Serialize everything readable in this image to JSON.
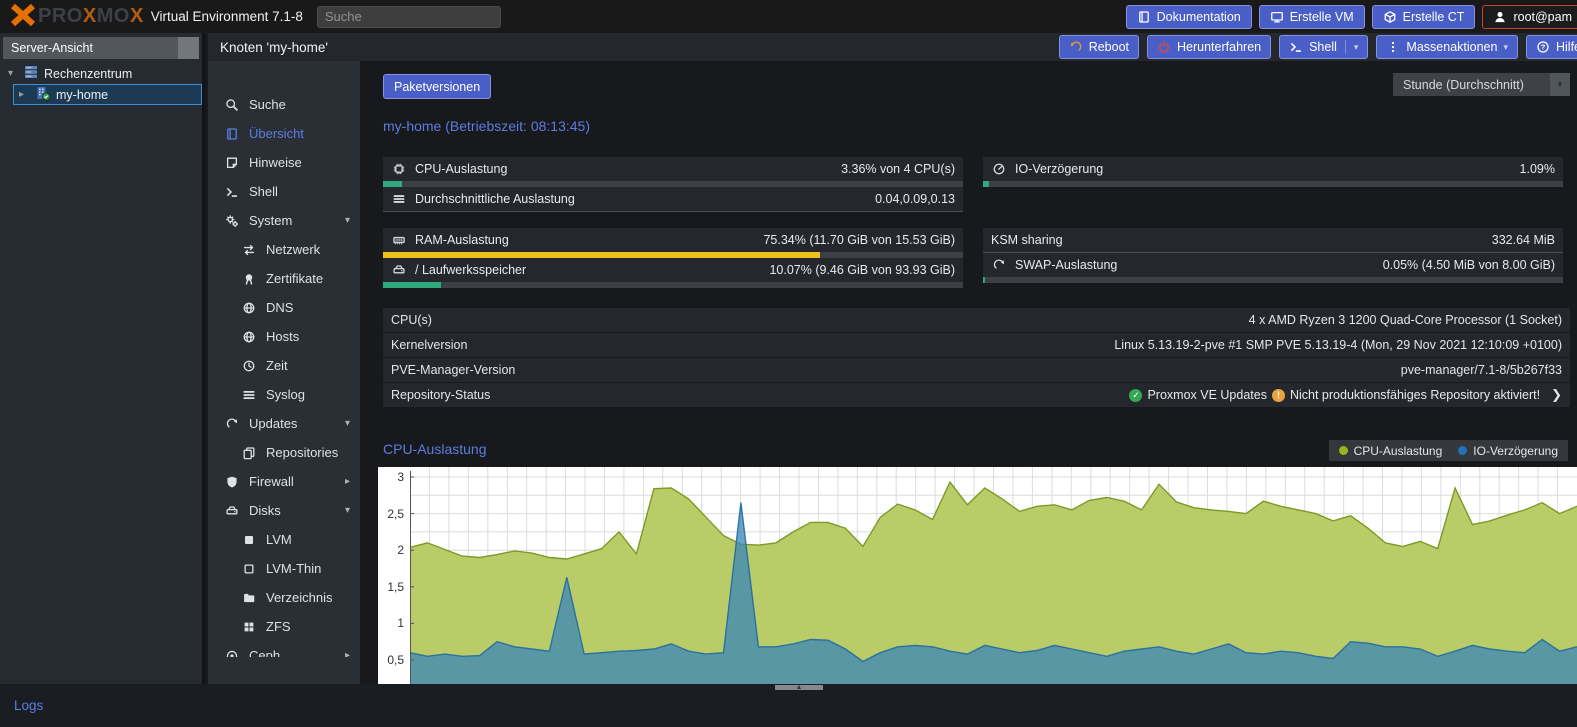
{
  "topbar": {
    "logo_text": "PROXMOX",
    "env_text": "Virtual Environment 7.1-8",
    "search_placeholder": "Suche",
    "buttons": [
      {
        "label": "Dokumentation",
        "icon": "book-icon"
      },
      {
        "label": "Erstelle VM",
        "icon": "display-icon"
      },
      {
        "label": "Erstelle CT",
        "icon": "cube-icon"
      }
    ],
    "user_button": {
      "label": "root@pam",
      "icon": "user-icon",
      "border_color": "#c8432e"
    }
  },
  "tree": {
    "view_label": "Server-Ansicht",
    "items": [
      {
        "label": "Rechenzentrum",
        "icon": "datacenter-icon",
        "level": 0,
        "selected": false
      },
      {
        "label": "my-home",
        "icon": "node-icon",
        "level": 1,
        "selected": true
      }
    ]
  },
  "node_toolbar": {
    "title": "Knoten 'my-home'",
    "buttons": [
      {
        "label": "Reboot",
        "icon": "reboot-icon",
        "icon_color": "#dba225"
      },
      {
        "label": "Herunterfahren",
        "icon": "power-icon",
        "icon_color": "#cc4b4b"
      },
      {
        "label": "Shell",
        "icon": "terminal-icon",
        "split": true
      },
      {
        "label": "Massenaktionen",
        "icon": "dots-icon",
        "caret": true
      },
      {
        "label": "Hilfe",
        "icon": "help-icon"
      }
    ]
  },
  "menu": {
    "items": [
      {
        "label": "Suche",
        "icon": "search-icon",
        "indent": 0
      },
      {
        "label": "Übersicht",
        "icon": "book-icon",
        "indent": 0,
        "active": true
      },
      {
        "label": "Hinweise",
        "icon": "note-icon",
        "indent": 0
      },
      {
        "label": "Shell",
        "icon": "terminal-icon",
        "indent": 0
      },
      {
        "label": "System",
        "icon": "gears-icon",
        "indent": 0,
        "caret": "down"
      },
      {
        "label": "Netzwerk",
        "icon": "network-icon",
        "indent": 1
      },
      {
        "label": "Zertifikate",
        "icon": "certificate-icon",
        "indent": 1
      },
      {
        "label": "DNS",
        "icon": "globe-icon",
        "indent": 1
      },
      {
        "label": "Hosts",
        "icon": "globe-icon",
        "indent": 1
      },
      {
        "label": "Zeit",
        "icon": "clock-icon",
        "indent": 1
      },
      {
        "label": "Syslog",
        "icon": "list-icon",
        "indent": 1
      },
      {
        "label": "Updates",
        "icon": "refresh-icon",
        "indent": 0,
        "caret": "down"
      },
      {
        "label": "Repositories",
        "icon": "copy-icon",
        "indent": 1
      },
      {
        "label": "Firewall",
        "icon": "shield-icon",
        "indent": 0,
        "caret": "right"
      },
      {
        "label": "Disks",
        "icon": "hdd-icon",
        "indent": 0,
        "caret": "down"
      },
      {
        "label": "LVM",
        "icon": "square-icon",
        "indent": 1
      },
      {
        "label": "LVM-Thin",
        "icon": "square-outline-icon",
        "indent": 1
      },
      {
        "label": "Verzeichnis",
        "icon": "folder-icon",
        "indent": 1
      },
      {
        "label": "ZFS",
        "icon": "grid-icon",
        "indent": 1
      },
      {
        "label": "Ceph",
        "icon": "ceph-icon",
        "indent": 0,
        "caret": "right"
      }
    ]
  },
  "content": {
    "pkg_button": "Paketversionen",
    "period_select": "Stunde (Durchschnitt)",
    "panel_title": "my-home (Betriebszeit: 08:13:45)",
    "stats_left": [
      {
        "icon": "cpu-icon",
        "label": "CPU-Auslastung",
        "value": "3.36% von 4 CPU(s)",
        "bar_pct": 3.36,
        "bar_color": "#2fa87c"
      },
      {
        "icon": "loadavg-icon",
        "label": "Durchschnittliche Auslastung",
        "value": "0.04,0.09,0.13",
        "divider": true
      },
      {
        "spacer": 16
      },
      {
        "icon": "ram-icon",
        "label": "RAM-Auslastung",
        "value": "75.34% (11.70 GiB von 15.53 GiB)",
        "bar_pct": 75.34,
        "bar_color": "#eec01c"
      },
      {
        "icon": "hdd-icon",
        "label": "/ Laufwerksspeicher",
        "value": "10.07% (9.46 GiB von 93.93 GiB)",
        "bar_pct": 10.07,
        "bar_color": "#2fa87c"
      }
    ],
    "stats_right": [
      {
        "icon": "gauge-icon",
        "label": "IO-Verzögerung",
        "value": "1.09%",
        "bar_pct": 1.09,
        "bar_color": "#2fa87c"
      },
      {
        "spacer": 41
      },
      {
        "label": "KSM sharing",
        "value": "332.64 MiB",
        "divider": true
      },
      {
        "icon": "refresh-icon",
        "label": "SWAP-Auslastung",
        "value": "0.05% (4.50 MiB von 8.00 GiB)",
        "bar_pct": 0.05,
        "bar_color": "#2fa87c"
      }
    ],
    "info_rows": [
      {
        "label": "CPU(s)",
        "value": "4 x AMD Ryzen 3 1200 Quad-Core Processor (1 Socket)"
      },
      {
        "label": "Kernelversion",
        "value": "Linux 5.13.19-2-pve #1 SMP PVE 5.13.19-4 (Mon, 29 Nov 2021 12:10:09 +0100)"
      },
      {
        "label": "PVE-Manager-Version",
        "value": "pve-manager/7.1-8/5b267f33"
      }
    ],
    "repo_row": {
      "label": "Repository-Status",
      "ok_text": "Proxmox VE Updates",
      "ok_color": "#35a854",
      "warn_text": "Nicht produktionsfähiges Repository aktiviert!",
      "warn_color": "#e8a33d"
    }
  },
  "chart_data": {
    "type": "area",
    "title": "CPU-Auslastung",
    "legend_position": "top-right",
    "grid": true,
    "ylim": [
      0,
      3
    ],
    "y_ticks": [
      "3",
      "2,5",
      "2",
      "1,5",
      "1",
      "0,5"
    ],
    "y_tick_values": [
      3,
      2.5,
      2,
      1.5,
      1,
      0.5
    ],
    "series": [
      {
        "name": "CPU-Auslastung",
        "legend_color": "#9cb31f",
        "fill": "#b9cc68",
        "stroke": "#7d9a26",
        "values": [
          2.04,
          2.1,
          2.01,
          1.92,
          1.9,
          1.94,
          1.99,
          1.96,
          1.9,
          1.88,
          1.95,
          2.02,
          2.25,
          1.95,
          2.84,
          2.85,
          2.7,
          2.45,
          2.2,
          2.08,
          2.07,
          2.1,
          2.25,
          2.38,
          2.38,
          2.3,
          2.05,
          2.45,
          2.63,
          2.55,
          2.42,
          2.93,
          2.62,
          2.85,
          2.7,
          2.53,
          2.6,
          2.62,
          2.55,
          2.68,
          2.72,
          2.67,
          2.55,
          2.9,
          2.66,
          2.58,
          2.55,
          2.53,
          2.5,
          2.67,
          2.6,
          2.55,
          2.5,
          2.4,
          2.47,
          2.3,
          2.1,
          2.05,
          2.12,
          2.02,
          2.85,
          2.35,
          2.4,
          2.48,
          2.55,
          2.65,
          2.5,
          2.6
        ]
      },
      {
        "name": "IO-Verzögerung",
        "legend_color": "#2273b5",
        "fill": "rgba(58,134,186,0.75)",
        "stroke": "rgba(32,108,160,0.9)",
        "values": [
          0.6,
          0.55,
          0.58,
          0.55,
          0.56,
          0.75,
          0.68,
          0.65,
          0.62,
          1.63,
          0.58,
          0.6,
          0.62,
          0.63,
          0.65,
          0.72,
          0.62,
          0.58,
          0.6,
          2.65,
          0.68,
          0.68,
          0.72,
          0.78,
          0.77,
          0.65,
          0.48,
          0.6,
          0.68,
          0.7,
          0.68,
          0.62,
          0.58,
          0.7,
          0.65,
          0.6,
          0.63,
          0.7,
          0.65,
          0.6,
          0.55,
          0.62,
          0.65,
          0.68,
          0.62,
          0.58,
          0.65,
          0.72,
          0.6,
          0.58,
          0.62,
          0.6,
          0.55,
          0.52,
          0.75,
          0.73,
          0.68,
          0.68,
          0.65,
          0.55,
          0.62,
          0.7,
          0.65,
          0.62,
          0.6,
          0.78,
          0.62,
          0.68
        ]
      }
    ]
  },
  "bottom": {
    "logs_label": "Logs"
  }
}
